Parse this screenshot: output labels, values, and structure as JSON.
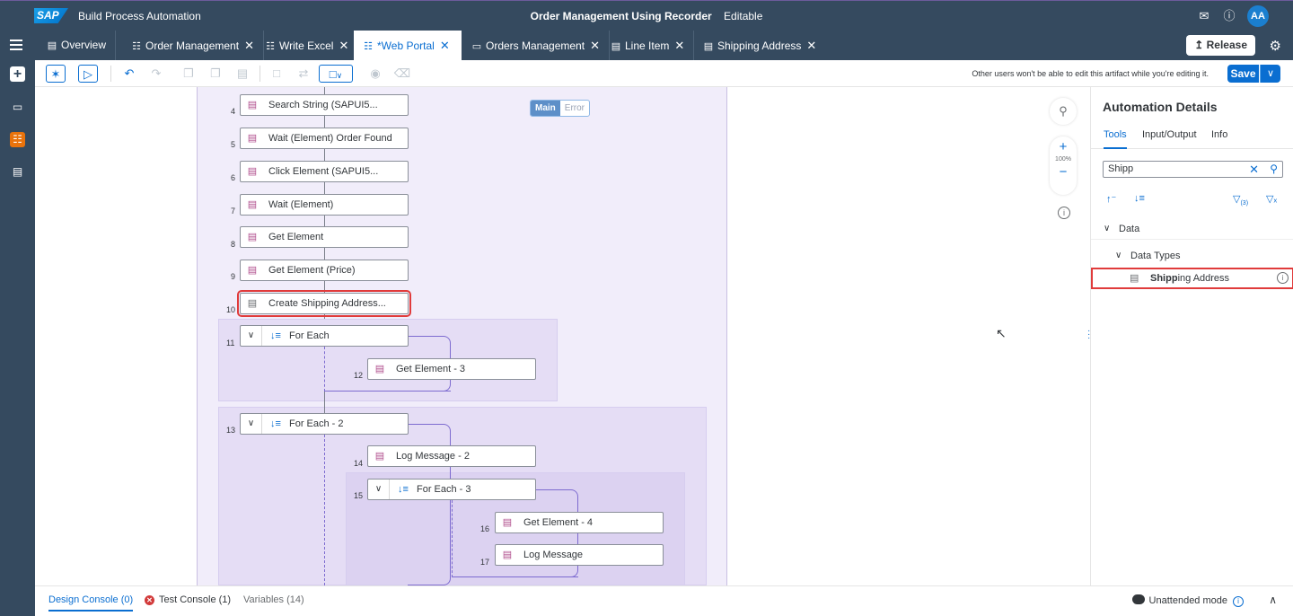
{
  "shell": {
    "logo": "SAP",
    "app_title": "Build Process Automation",
    "project_title": "Order Management Using Recorder",
    "mode": "Editable",
    "avatar": "AA"
  },
  "tabs": [
    {
      "label": "Overview",
      "icon": "file-icon",
      "closable": false
    },
    {
      "label": "Order Management",
      "icon": "process-icon",
      "closable": true
    },
    {
      "label": "Write Excel",
      "icon": "process-icon",
      "closable": true
    },
    {
      "label": "*Web Portal",
      "icon": "process-icon",
      "closable": true,
      "active": true
    },
    {
      "label": "Orders Management",
      "icon": "screen-icon",
      "closable": true
    },
    {
      "label": "Line Item",
      "icon": "datatype-icon",
      "closable": true
    },
    {
      "label": "Shipping Address",
      "icon": "datatype-icon",
      "closable": true
    }
  ],
  "release_label": "Release",
  "toolbar": {
    "lock_message": "Other users won't be able to edit this artifact while you're editing it.",
    "save_label": "Save"
  },
  "canvas": {
    "toggle_main": "Main",
    "toggle_error": "Error",
    "zoom": "100%",
    "steps": [
      {
        "num": "4",
        "label": "Search String (SAPUI5..."
      },
      {
        "num": "5",
        "label": "Wait (Element) Order Found"
      },
      {
        "num": "6",
        "label": "Click Element (SAPUI5..."
      },
      {
        "num": "7",
        "label": "Wait (Element)"
      },
      {
        "num": "8",
        "label": "Get Element"
      },
      {
        "num": "9",
        "label": "Get Element (Price)"
      },
      {
        "num": "10",
        "label": "Create Shipping Address..."
      },
      {
        "num": "11",
        "label": "For Each"
      },
      {
        "num": "12",
        "label": "Get Element - 3"
      },
      {
        "num": "13",
        "label": "For Each - 2"
      },
      {
        "num": "14",
        "label": "Log Message - 2"
      },
      {
        "num": "15",
        "label": "For Each - 3"
      },
      {
        "num": "16",
        "label": "Get Element - 4"
      },
      {
        "num": "17",
        "label": "Log Message"
      }
    ]
  },
  "details": {
    "title": "Automation Details",
    "tabs": [
      "Tools",
      "Input/Output",
      "Info"
    ],
    "search_value": "Shipp",
    "filter_count": "(3)",
    "tree": {
      "root": "Data",
      "group": "Data Types",
      "item_match": "Shipp",
      "item_rest": "ing Address"
    }
  },
  "bottom": {
    "design_console": "Design Console (0)",
    "test_console": "Test Console (1)",
    "variables": "Variables (14)",
    "mode": "Unattended mode"
  }
}
